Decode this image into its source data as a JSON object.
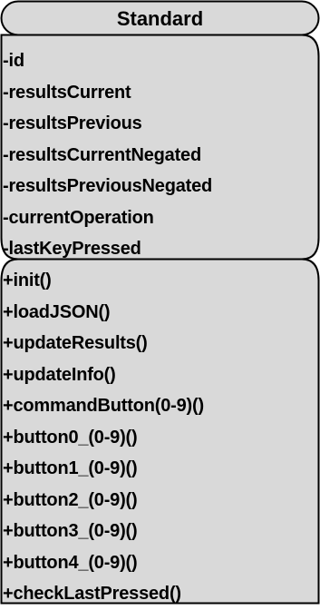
{
  "class_box": {
    "name": "Standard",
    "attributes": [
      "-id",
      "-resultsCurrent",
      "-resultsPrevious",
      "-resultsCurrentNegated",
      "-resultsPreviousNegated",
      "-currentOperation",
      "-lastKeyPressed"
    ],
    "methods": [
      "+init()",
      "+loadJSON()",
      "+updateResults()",
      "+updateInfo()",
      "+commandButton(0-9)()",
      "+button0_(0-9)()",
      "+button1_(0-9)()",
      "+button2_(0-9)()",
      "+button3_(0-9)()",
      "+button4_(0-9)()",
      "+checkLastPressed()"
    ]
  },
  "colors": {
    "fill": "#d9d9d9",
    "stroke": "#000000",
    "text": "#000000"
  }
}
